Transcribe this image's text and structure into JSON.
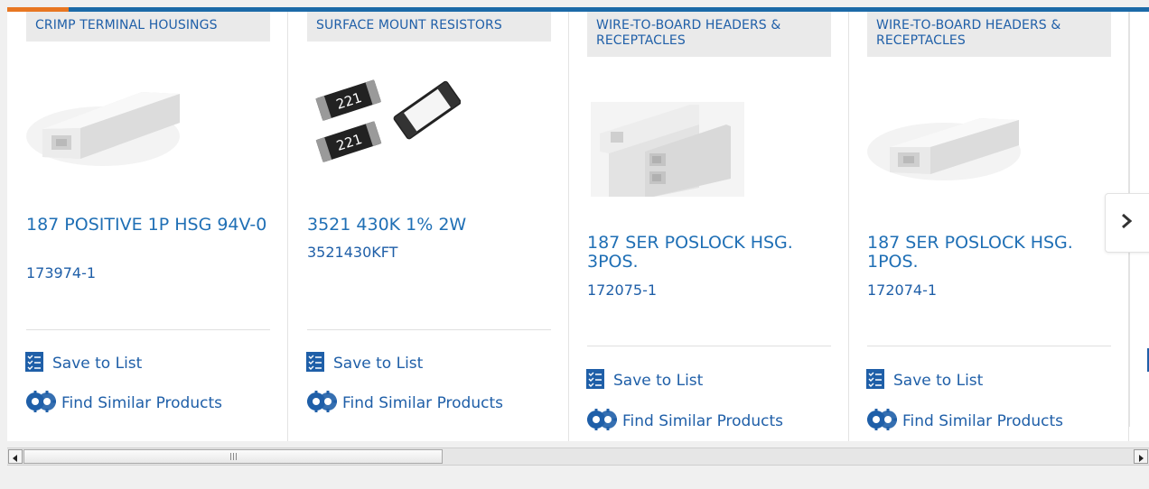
{
  "cards": [
    {
      "category": "CRIMP TERMINAL HOUSINGS",
      "title": "187 POSITIVE 1P HSG 94V-0",
      "part_number": "173974-1",
      "save_label": "Save to List",
      "similar_label": "Find Similar Products",
      "image_icon": "crimp-housing-1pos"
    },
    {
      "category": "SURFACE MOUNT RESISTORS",
      "title": "3521 430K 1% 2W",
      "part_number": "3521430KFT",
      "save_label": "Save to List",
      "similar_label": "Find Similar Products",
      "image_icon": "smd-resistors",
      "resistor_marking": "221"
    },
    {
      "category": "WIRE-TO-BOARD HEADERS & RECEPTACLES",
      "title": "187 SER POSLOCK HSG. 3POS.",
      "part_number": "172075-1",
      "save_label": "Save to List",
      "similar_label": "Find Similar Products",
      "image_icon": "poslock-housing-3pos"
    },
    {
      "category": "WIRE-TO-BOARD HEADERS & RECEPTACLES",
      "title": "187 SER POSLOCK HSG. 1POS.",
      "part_number": "172074-1",
      "save_label": "Save to List",
      "similar_label": "Find Similar Products",
      "image_icon": "poslock-housing-1pos"
    }
  ],
  "colors": {
    "brand_blue": "#1f5fa8",
    "link_blue": "#1f6fb5",
    "accent_orange": "#e87722",
    "top_bar_blue": "#1c6aa8"
  }
}
